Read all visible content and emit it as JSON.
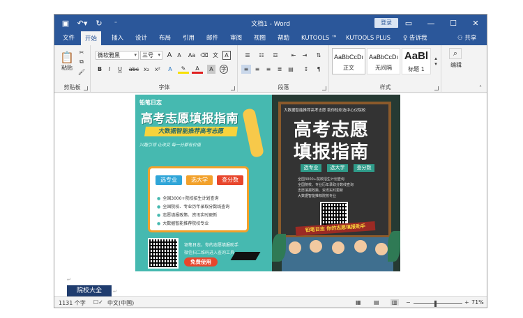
{
  "window": {
    "title": "文档1 - Word",
    "login": "登录"
  },
  "tabs": [
    "文件",
    "开始",
    "插入",
    "设计",
    "布局",
    "引用",
    "邮件",
    "审阅",
    "视图",
    "帮助",
    "KUTOOLS ™",
    "KUTOOLS PLUS",
    "告诉我",
    "共享"
  ],
  "ribbon": {
    "clipboard": {
      "paste": "粘贴",
      "label": "剪贴板"
    },
    "font": {
      "name": "微软雅黑",
      "size": "三号",
      "grow": "A",
      "shrink": "A",
      "case": "Aa",
      "bold": "B",
      "italic": "I",
      "underline": "U",
      "strike": "abc",
      "sub": "x₂",
      "sup": "x²",
      "label": "字体"
    },
    "paragraph": {
      "label": "段落"
    },
    "styles": {
      "items": [
        {
          "sample": "AaBbCcDı",
          "name": "正文"
        },
        {
          "sample": "AaBbCcDı",
          "name": "无间隔"
        },
        {
          "sample": "AaBl",
          "name": "标题 1"
        }
      ],
      "label": "样式"
    },
    "editing": {
      "label": "编辑"
    }
  },
  "poster": {
    "brand": "铅笔日志",
    "title_left": "高考志愿填报指南",
    "subtitle_left": "大数据智能推荐高考志愿",
    "handwriting": "兴趣引领 让改变 每一分都有价值",
    "pills": [
      "选专业",
      "选大学",
      "查分数"
    ],
    "features": [
      "全国3000+院校招生计划查询",
      "全国院校、专业历年录取分数线查询",
      "志愿填报政策、资讯实时更新",
      "大数据智能推荐院校专业"
    ],
    "promo1": "铅笔日志，你的志愿填报助手",
    "promo2": "微信扫二维码进入查询工具",
    "use_button": "免费使用",
    "right_top": "大数据智能推荐高考志愿 助你轻松选中心仪院校",
    "right_title_1": "高考志愿",
    "right_title_2": "填报指南",
    "right_pills": [
      "选专业",
      "选大学",
      "查分数"
    ],
    "right_lines": [
      "全国3000+院校招生计划查询",
      "全国院校、专业历年录取分数线查询",
      "志愿填报政策、资讯实时更新",
      "大数据智能推荐院校专业"
    ],
    "band": "铅笔日志 你的志愿填报助手"
  },
  "doc_tag": "院校大全",
  "status": {
    "words": "1131 个字",
    "lang": "中文(中国)",
    "zoom": "71%"
  },
  "colors": {
    "accent": "#2b579a",
    "teal": "#46b9b0",
    "orange": "#f2a12b",
    "red": "#e8462c"
  }
}
